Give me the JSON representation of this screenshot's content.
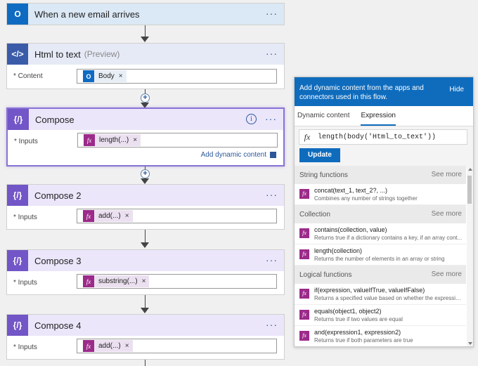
{
  "flow": {
    "trigger": {
      "title": "When a new email arrives",
      "menu": "···"
    },
    "html_to_text": {
      "title": "Html to text",
      "preview": "(Preview)",
      "menu": "···",
      "field_label": "* Content",
      "token": "Body",
      "token_remove": "×"
    },
    "compose1": {
      "title": "Compose",
      "menu": "···",
      "info": "i",
      "field_label": "* Inputs",
      "token": "length(...)",
      "token_remove": "×",
      "add_dynamic": "Add dynamic content"
    },
    "compose2": {
      "title": "Compose 2",
      "menu": "···",
      "field_label": "* Inputs",
      "token": "add(...)",
      "token_remove": "×"
    },
    "compose3": {
      "title": "Compose 3",
      "menu": "···",
      "field_label": "* Inputs",
      "token": "substring(...)",
      "token_remove": "×"
    },
    "compose4": {
      "title": "Compose 4",
      "menu": "···",
      "field_label": "* Inputs",
      "token": "add(...)",
      "token_remove": "×"
    },
    "plus": "+"
  },
  "panel": {
    "message": "Add dynamic content from the apps and connectors used in this flow.",
    "hide": "Hide",
    "tabs": [
      "Dynamic content",
      "Expression"
    ],
    "active_tab": "Expression",
    "fx": "fx",
    "expression": "length(body('Html_to_text'))",
    "update": "Update",
    "sections": [
      {
        "title": "String functions",
        "more": "See more",
        "items": [
          {
            "name": "concat(text_1, text_2?, ...)",
            "desc": "Combines any number of strings together"
          }
        ]
      },
      {
        "title": "Collection",
        "more": "See more",
        "items": [
          {
            "name": "contains(collection, value)",
            "desc": "Returns true if a dictionary contains a key, if an array cont..."
          },
          {
            "name": "length(collection)",
            "desc": "Returns the number of elements in an array or string"
          }
        ]
      },
      {
        "title": "Logical functions",
        "more": "See more",
        "items": [
          {
            "name": "if(expression, valueIfTrue, valueIfFalse)",
            "desc": "Returns a specified value based on whether the expressio..."
          },
          {
            "name": "equals(object1, object2)",
            "desc": "Returns true if two values are equal"
          },
          {
            "name": "and(expression1, expression2)",
            "desc": "Returns true if both parameters are true"
          }
        ]
      }
    ]
  },
  "colors": {
    "accent": "#0f6cbd",
    "compose_icon": "#7255c6",
    "fx_token": "#9c2a8a",
    "outlook": "#0f6bc1"
  },
  "icons": {
    "trigger": "outlook-icon",
    "html_to_text": "html-to-text-icon",
    "compose": "compose-icon",
    "expression": "fx-icon"
  }
}
